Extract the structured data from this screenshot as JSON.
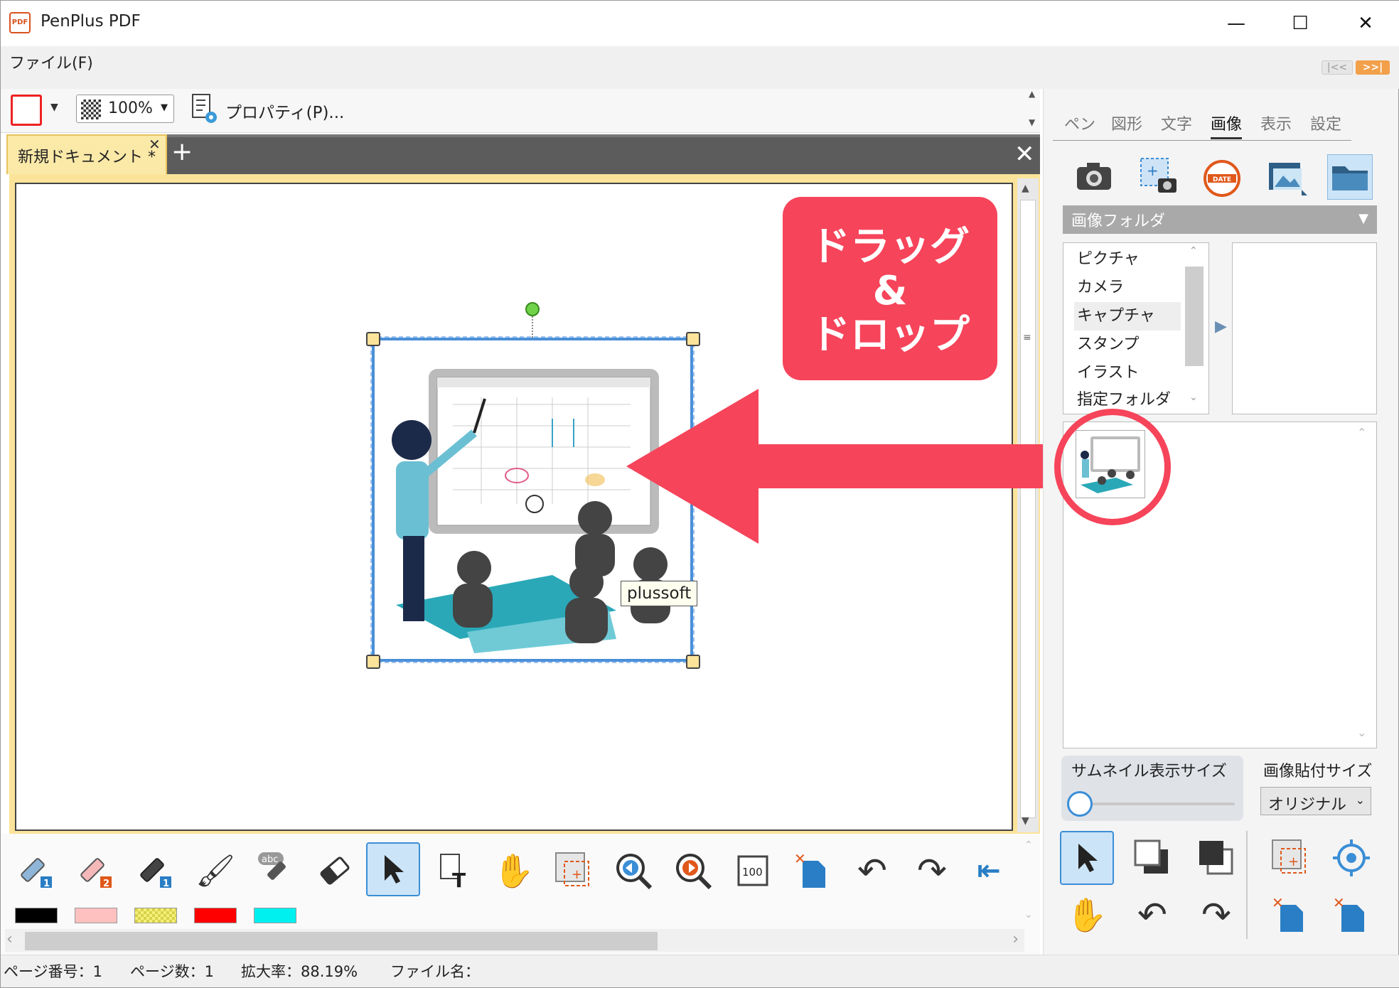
{
  "titlebar": {
    "app_title": "PenPlus PDF",
    "minimize": "—",
    "maximize": "☐",
    "close": "✕"
  },
  "menu": {
    "file": "ファイル(F)"
  },
  "toolbar": {
    "zoom_value": "100%",
    "properties_label": "プロパティ(P)..."
  },
  "document_tab": {
    "label": "新規ドキュメント *",
    "close": "✕",
    "add": "+"
  },
  "canvas": {
    "image_tooltip": "plussoft"
  },
  "callout": {
    "line1": "ドラッグ",
    "line2": "&",
    "line3": "ドロップ"
  },
  "panel": {
    "tabs": [
      "ペン",
      "図形",
      "文字",
      "画像",
      "表示",
      "設定"
    ],
    "active_tab": "画像",
    "folder_header": "画像フォルダ",
    "folders": [
      "ピクチャ",
      "カメラ",
      "キャプチャ",
      "スタンプ",
      "イラスト",
      "指定フォルダ"
    ],
    "selected_folder": "キャプチャ",
    "thumb_size_label": "サムネイル表示サイズ",
    "paste_size_label": "画像貼付サイズ",
    "paste_size_value": "オリジナル"
  },
  "colors": {
    "swatches": [
      "#000000",
      "#ffc0c0",
      "#f4f07a",
      "#ff0000",
      "#00f0f0"
    ],
    "accent": "#f6445a",
    "selection": "#3b8ed6"
  },
  "status": {
    "page_number": "ページ番号：1",
    "page_count": "ページ数：1",
    "zoom": "拡大率：88.19%",
    "file_name": "ファイル名："
  }
}
